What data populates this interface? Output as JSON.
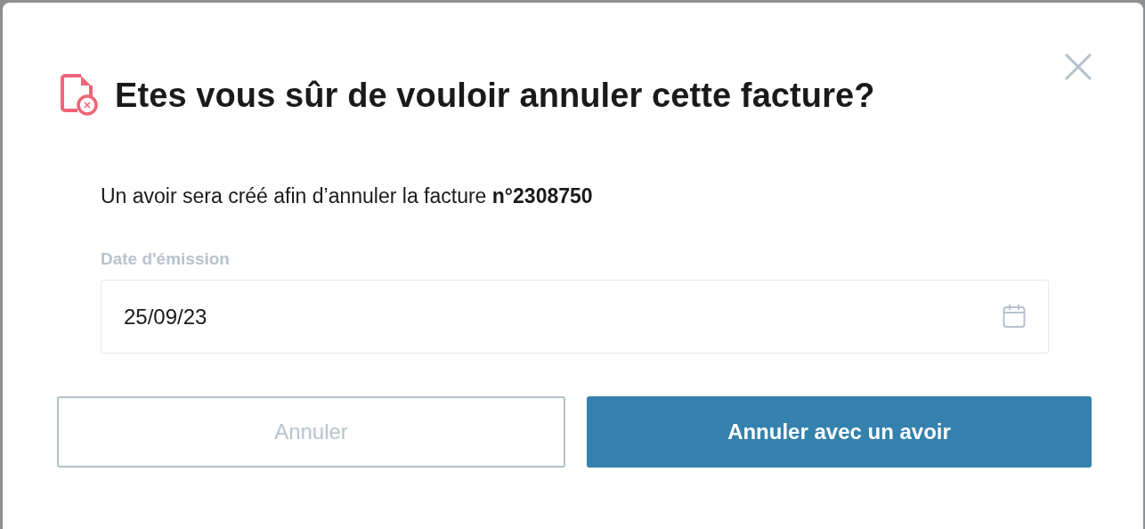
{
  "dialog": {
    "title": "Etes vous sûr de vouloir annuler cette facture?",
    "message": "Un avoir sera créé afin d’annuler la facture **n°2308750**",
    "date_field": {
      "label": "Date d'émission",
      "value": "25/09/23"
    },
    "buttons": [
      {
        "label": "Annuler",
        "kind": "secondary"
      },
      {
        "label": "Annuler avec un avoir",
        "kind": "primary"
      }
    ]
  }
}
